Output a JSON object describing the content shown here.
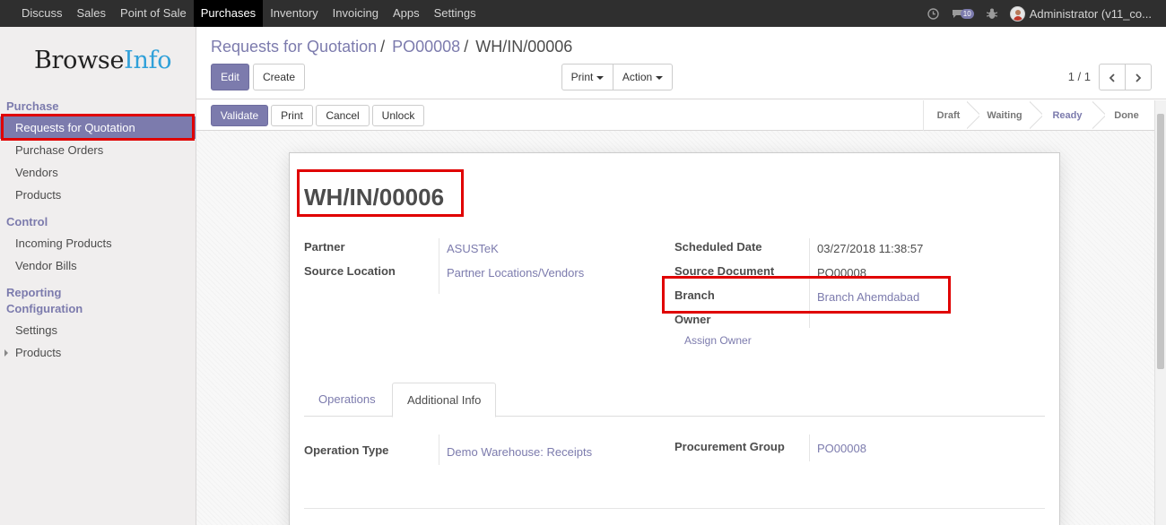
{
  "topbar": {
    "menu": [
      "Discuss",
      "Sales",
      "Point of Sale",
      "Purchases",
      "Inventory",
      "Invoicing",
      "Apps",
      "Settings"
    ],
    "active_menu": "Purchases",
    "messages_count": "10",
    "user": "Administrator (v11_co..."
  },
  "logo": {
    "part1": "Browse",
    "part2": "Info"
  },
  "sidebar": {
    "section_purchase": "Purchase",
    "items_purchase": [
      "Requests for Quotation",
      "Purchase Orders",
      "Vendors",
      "Products"
    ],
    "section_control": "Control",
    "items_control": [
      "Incoming Products",
      "Vendor Bills"
    ],
    "section_reporting": "Reporting",
    "section_configuration": "Configuration",
    "items_config": [
      "Settings",
      "Products"
    ]
  },
  "breadcrumb": {
    "level1": "Requests for Quotation",
    "level2": "PO00008",
    "current": "WH/IN/00006",
    "separator": "/"
  },
  "controls": {
    "edit": "Edit",
    "create": "Create",
    "print": "Print",
    "action": "Action",
    "pager": "1 / 1"
  },
  "statusbar": {
    "validate": "Validate",
    "print": "Print",
    "cancel": "Cancel",
    "unlock": "Unlock",
    "stages": [
      "Draft",
      "Waiting",
      "Ready",
      "Done"
    ],
    "active_stage": "Ready"
  },
  "form": {
    "title": "WH/IN/00006",
    "partner_label": "Partner",
    "partner": "ASUSTeK",
    "source_location_label": "Source Location",
    "source_location": "Partner Locations/Vendors",
    "scheduled_date_label": "Scheduled Date",
    "scheduled_date": "03/27/2018 11:38:57",
    "source_document_label": "Source Document",
    "source_document": "PO00008",
    "branch_label": "Branch",
    "branch": "Branch Ahemdabad",
    "owner_label": "Owner",
    "assign_owner": "Assign Owner",
    "tabs": [
      "Operations",
      "Additional Info"
    ],
    "active_tab": "Additional Info",
    "operation_type_label": "Operation Type",
    "operation_type": "Demo Warehouse: Receipts",
    "procurement_group_label": "Procurement Group",
    "procurement_group": "PO00008"
  },
  "colors": {
    "brand": "#7c7bad",
    "navbar": "#2f2f2f",
    "highlight": "#e00000",
    "logo_info": "#2fa0d9"
  }
}
